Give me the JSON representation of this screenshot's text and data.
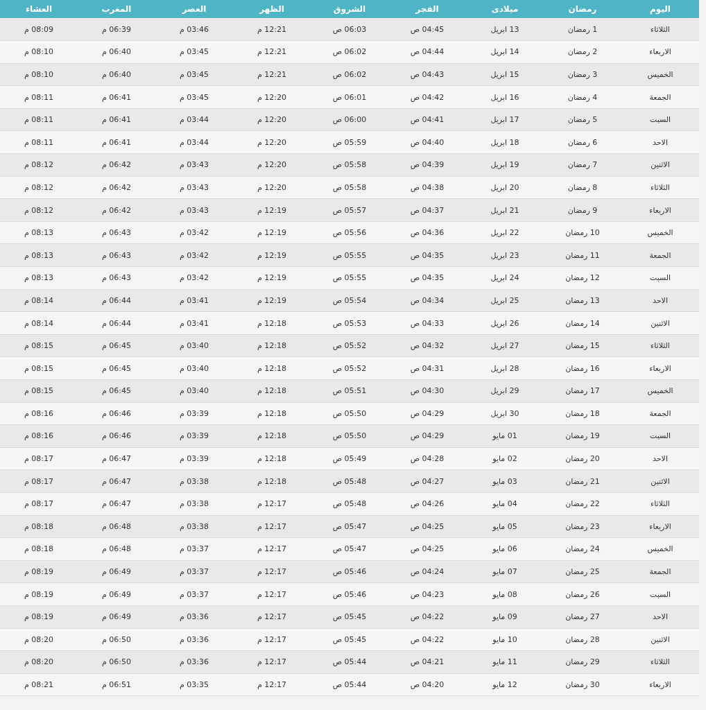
{
  "table": {
    "columns": [
      "اليوم",
      "رمضان",
      "ميلادى",
      "الفجر",
      "الشروق",
      "الظهر",
      "العصر",
      "المغرب",
      "العشاء"
    ],
    "rows": [
      [
        "الثلاثاء",
        "1 رمضان",
        "13 ابريل",
        "04:45 ص",
        "06:03 ص",
        "12:21 م",
        "03:46 م",
        "06:39 م",
        "08:09 م"
      ],
      [
        "الاربعاء",
        "2 رمضان",
        "14 ابريل",
        "04:44 ص",
        "06:02 ص",
        "12:21 م",
        "03:45 م",
        "06:40 م",
        "08:10 م"
      ],
      [
        "الخميس",
        "3 رمضان",
        "15 ابريل",
        "04:43 ص",
        "06:02 ص",
        "12:21 م",
        "03:45 م",
        "06:40 م",
        "08:10 م"
      ],
      [
        "الجمعة",
        "4 رمضان",
        "16 ابريل",
        "04:42 ص",
        "06:01 ص",
        "12:20 م",
        "03:45 م",
        "06:41 م",
        "08:11 م"
      ],
      [
        "السبت",
        "5 رمضان",
        "17 ابريل",
        "04:41 ص",
        "06:00 ص",
        "12:20 م",
        "03:44 م",
        "06:41 م",
        "08:11 م"
      ],
      [
        "الاحد",
        "6 رمضان",
        "18 ابريل",
        "04:40 ص",
        "05:59 ص",
        "12:20 م",
        "03:44 م",
        "06:41 م",
        "08:11 م"
      ],
      [
        "الاثنين",
        "7 رمضان",
        "19 ابريل",
        "04:39 ص",
        "05:58 ص",
        "12:20 م",
        "03:43 م",
        "06:42 م",
        "08:12 م"
      ],
      [
        "الثلاثاء",
        "8 رمضان",
        "20 ابريل",
        "04:38 ص",
        "05:58 ص",
        "12:20 م",
        "03:43 م",
        "06:42 م",
        "08:12 م"
      ],
      [
        "الاربعاء",
        "9 رمضان",
        "21 ابريل",
        "04:37 ص",
        "05:57 ص",
        "12:19 م",
        "03:43 م",
        "06:42 م",
        "08:12 م"
      ],
      [
        "الخميس",
        "10 رمضان",
        "22 ابريل",
        "04:36 ص",
        "05:56 ص",
        "12:19 م",
        "03:42 م",
        "06:43 م",
        "08:13 م"
      ],
      [
        "الجمعة",
        "11 رمضان",
        "23 ابريل",
        "04:35 ص",
        "05:55 ص",
        "12:19 م",
        "03:42 م",
        "06:43 م",
        "08:13 م"
      ],
      [
        "السبت",
        "12 رمضان",
        "24 ابريل",
        "04:35 ص",
        "05:55 ص",
        "12:19 م",
        "03:42 م",
        "06:43 م",
        "08:13 م"
      ],
      [
        "الاحد",
        "13 رمضان",
        "25 ابريل",
        "04:34 ص",
        "05:54 ص",
        "12:19 م",
        "03:41 م",
        "06:44 م",
        "08:14 م"
      ],
      [
        "الاثنين",
        "14 رمضان",
        "26 ابريل",
        "04:33 ص",
        "05:53 ص",
        "12:18 م",
        "03:41 م",
        "06:44 م",
        "08:14 م"
      ],
      [
        "الثلاثاء",
        "15 رمضان",
        "27 ابريل",
        "04:32 ص",
        "05:52 ص",
        "12:18 م",
        "03:40 م",
        "06:45 م",
        "08:15 م"
      ],
      [
        "الاربعاء",
        "16 رمضان",
        "28 ابريل",
        "04:31 ص",
        "05:52 ص",
        "12:18 م",
        "03:40 م",
        "06:45 م",
        "08:15 م"
      ],
      [
        "الخميس",
        "17 رمضان",
        "29 ابريل",
        "04:30 ص",
        "05:51 ص",
        "12:18 م",
        "03:40 م",
        "06:45 م",
        "08:15 م"
      ],
      [
        "الجمعة",
        "18 رمضان",
        "30 ابريل",
        "04:29 ص",
        "05:50 ص",
        "12:18 م",
        "03:39 م",
        "06:46 م",
        "08:16 م"
      ],
      [
        "السبت",
        "19 رمضان",
        "01 مايو",
        "04:29 ص",
        "05:50 ص",
        "12:18 م",
        "03:39 م",
        "06:46 م",
        "08:16 م"
      ],
      [
        "الاحد",
        "20 رمضان",
        "02 مايو",
        "04:28 ص",
        "05:49 ص",
        "12:18 م",
        "03:39 م",
        "06:47 م",
        "08:17 م"
      ],
      [
        "الاثنين",
        "21 رمضان",
        "03 مايو",
        "04:27 ص",
        "05:48 ص",
        "12:18 م",
        "03:38 م",
        "06:47 م",
        "08:17 م"
      ],
      [
        "الثلاثاء",
        "22 رمضان",
        "04 مايو",
        "04:26 ص",
        "05:48 ص",
        "12:17 م",
        "03:38 م",
        "06:47 م",
        "08:17 م"
      ],
      [
        "الاربعاء",
        "23 رمضان",
        "05 مايو",
        "04:25 ص",
        "05:47 ص",
        "12:17 م",
        "03:38 م",
        "06:48 م",
        "08:18 م"
      ],
      [
        "الخميس",
        "24 رمضان",
        "06 مايو",
        "04:25 ص",
        "05:47 ص",
        "12:17 م",
        "03:37 م",
        "06:48 م",
        "08:18 م"
      ],
      [
        "الجمعة",
        "25 رمضان",
        "07 مايو",
        "04:24 ص",
        "05:46 ص",
        "12:17 م",
        "03:37 م",
        "06:49 م",
        "08:19 م"
      ],
      [
        "السبت",
        "26 رمضان",
        "08 مايو",
        "04:23 ص",
        "05:46 ص",
        "12:17 م",
        "03:37 م",
        "06:49 م",
        "08:19 م"
      ],
      [
        "الاحد",
        "27 رمضان",
        "09 مايو",
        "04:22 ص",
        "05:45 ص",
        "12:17 م",
        "03:36 م",
        "06:49 م",
        "08:19 م"
      ],
      [
        "الاثنين",
        "28 رمضان",
        "10 مايو",
        "04:22 ص",
        "05:45 ص",
        "12:17 م",
        "03:36 م",
        "06:50 م",
        "08:20 م"
      ],
      [
        "الثلاثاء",
        "29 رمضان",
        "11 مايو",
        "04:21 ص",
        "05:44 ص",
        "12:17 م",
        "03:36 م",
        "06:50 م",
        "08:20 م"
      ],
      [
        "الاربعاء",
        "30 رمضان",
        "12 مايو",
        "04:20 ص",
        "05:44 ص",
        "12:17 م",
        "03:35 م",
        "06:51 م",
        "08:21 م"
      ]
    ]
  }
}
